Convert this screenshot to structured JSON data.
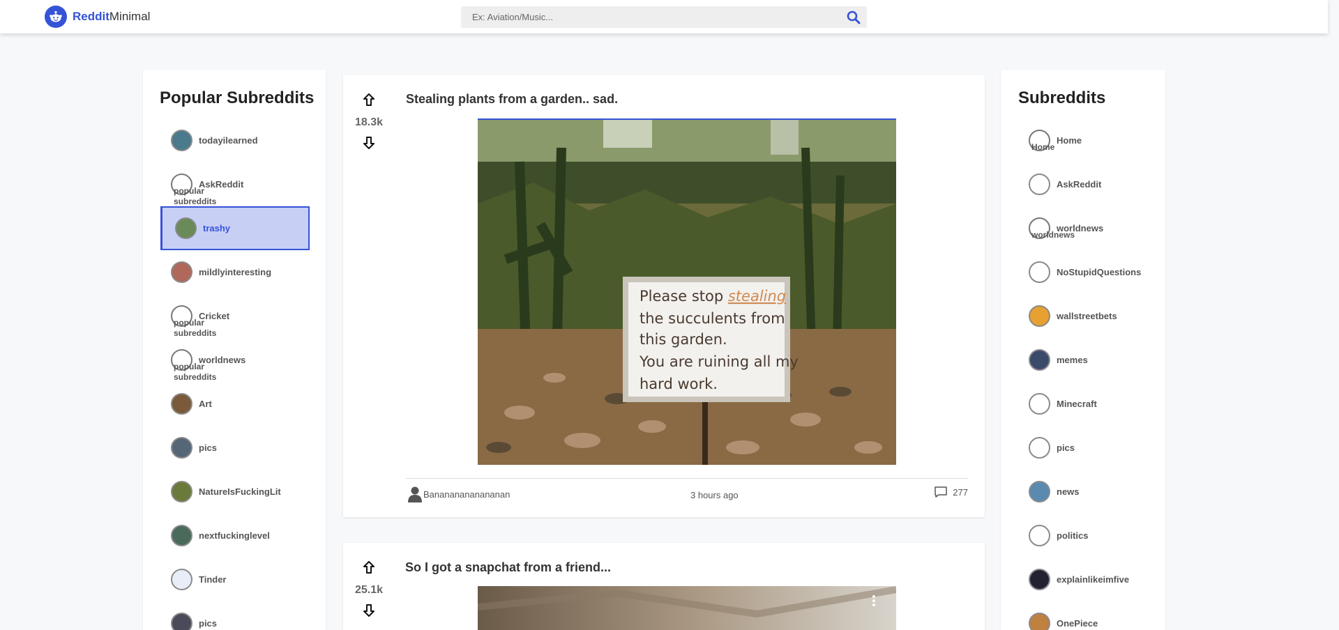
{
  "brand": {
    "part1": "Reddit",
    "part2": "Minimal"
  },
  "search": {
    "placeholder": "Ex: Aviation/Music..."
  },
  "left_panel": {
    "title": "Popular Subreddits",
    "broken_alt": "popular subreddits",
    "items": [
      {
        "label": "todayilearned",
        "color": "#4a7a8c",
        "broken": false
      },
      {
        "label": "AskReddit",
        "broken": true
      },
      {
        "label": "trashy",
        "color": "#6a8a5a",
        "broken": false,
        "active": true
      },
      {
        "label": "mildlyinteresting",
        "color": "#b0685a",
        "broken": false
      },
      {
        "label": "Cricket",
        "broken": true
      },
      {
        "label": "worldnews",
        "broken": true
      },
      {
        "label": "Art",
        "color": "#7a5a3a",
        "broken": false
      },
      {
        "label": "pics",
        "color": "#556677",
        "broken": false
      },
      {
        "label": "NatureIsFuckingLit",
        "color": "#6a7a3a",
        "broken": false
      },
      {
        "label": "nextfuckinglevel",
        "color": "#4a6a5a",
        "broken": false
      },
      {
        "label": "Tinder",
        "color": "#e8eef8",
        "broken": false
      },
      {
        "label": "pics",
        "color": "#4a4a5a",
        "broken": false
      }
    ]
  },
  "right_panel": {
    "title": "Subreddits",
    "items": [
      {
        "label": "Home",
        "broken": true,
        "alt": "Home"
      },
      {
        "label": "AskReddit",
        "color": "#ffffff",
        "broken": false
      },
      {
        "label": "worldnews",
        "broken": true,
        "alt": "worldnews"
      },
      {
        "label": "NoStupidQuestions",
        "color": "#ffffff",
        "broken": false
      },
      {
        "label": "wallstreetbets",
        "color": "#e8a030",
        "broken": false
      },
      {
        "label": "memes",
        "color": "#3a4a6a",
        "broken": false
      },
      {
        "label": "Minecraft",
        "color": "#ffffff",
        "broken": false
      },
      {
        "label": "pics",
        "color": "#ffffff",
        "broken": false
      },
      {
        "label": "news",
        "color": "#5a8ab0",
        "broken": false
      },
      {
        "label": "politics",
        "color": "#ffffff",
        "broken": false
      },
      {
        "label": "explainlikeimfive",
        "color": "#222233",
        "broken": false
      },
      {
        "label": "OnePiece",
        "color": "#c08040",
        "broken": false
      }
    ]
  },
  "posts": [
    {
      "title": "Stealing plants from a garden.. sad.",
      "score": "18.3k",
      "author": "Banananananananan",
      "time": "3 hours ago",
      "comments": "277",
      "image_sign_lines": [
        "Please stop stealing",
        "the succulents from",
        "this garden.",
        "You are ruining all my",
        "hard  work."
      ]
    },
    {
      "title": "So I got a snapchat from a friend...",
      "score": "25.1k"
    }
  ]
}
